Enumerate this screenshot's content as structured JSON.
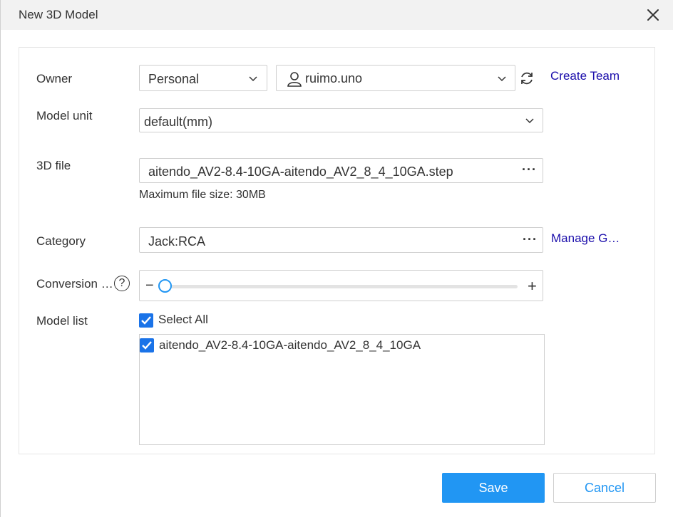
{
  "dialog": {
    "title": "New 3D Model",
    "close_icon": "close-icon"
  },
  "owner": {
    "label": "Owner",
    "type_value": "Personal",
    "user_value": "ruimo.uno",
    "user_icon": "person-icon",
    "refresh_icon": "refresh-icon",
    "create_team": "Create Team"
  },
  "model_unit": {
    "label": "Model unit",
    "value": "default(mm)"
  },
  "file": {
    "label": "3D file",
    "value": "aitendo_AV2-8.4-10GA-aitendo_AV2_8_4_10GA.step",
    "browse": "···",
    "hint": "Maximum file size: 30MB"
  },
  "category": {
    "label": "Category",
    "value": "Jack:RCA",
    "browse": "···",
    "manage": "Manage G…"
  },
  "conversion": {
    "label": "Conversion …",
    "help": "?",
    "minus": "−",
    "plus": "+",
    "slider_level": 0
  },
  "model_list": {
    "label": "Model list",
    "select_all": "Select All",
    "select_all_checked": true,
    "items": [
      {
        "name": "aitendo_AV2-8.4-10GA-aitendo_AV2_8_4_10GA",
        "checked": true
      }
    ]
  },
  "footer": {
    "save": "Save",
    "cancel": "Cancel"
  },
  "colors": {
    "accent": "#2196f3",
    "checkbox": "#1a73e8",
    "link": "#1a0dab",
    "titlebar": "#f2f2f2"
  }
}
